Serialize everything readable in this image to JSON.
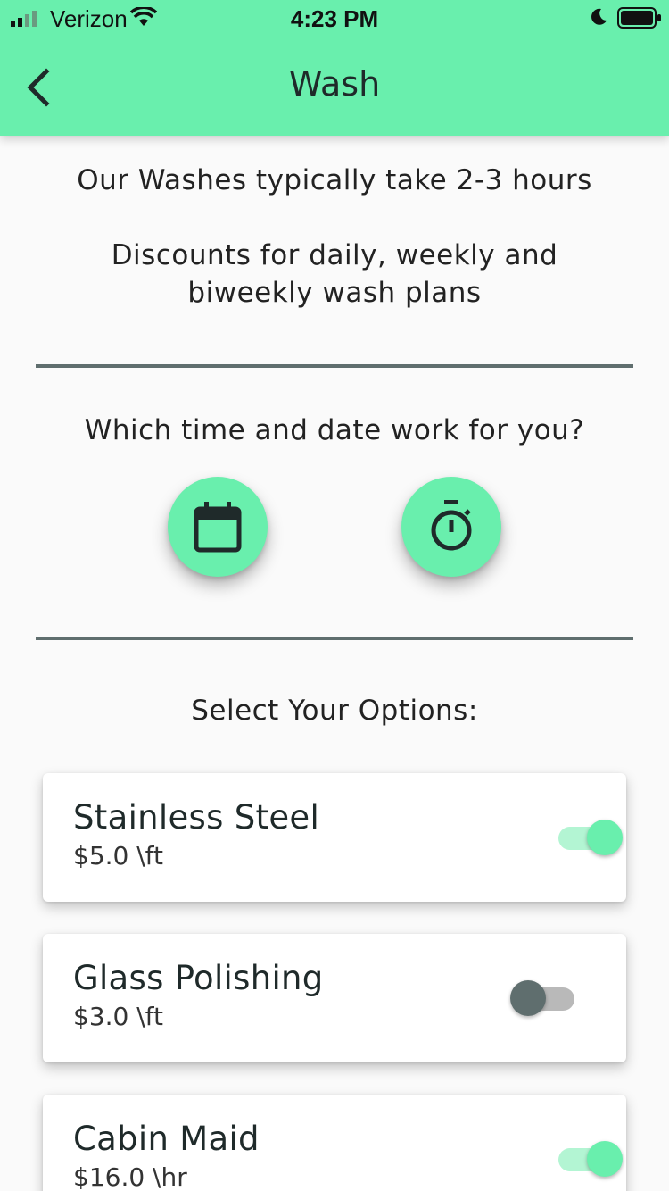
{
  "status_bar": {
    "carrier": "Verizon",
    "time": "4:23 PM"
  },
  "app_bar": {
    "title": "Wash"
  },
  "info": {
    "duration": "Our Washes typically take 2-3 hours",
    "discount_line1": "Discounts for daily, weekly and",
    "discount_line2": "biweekly wash plans"
  },
  "schedule": {
    "prompt": "Which time and date work for you?",
    "date_icon": "calendar-icon",
    "time_icon": "timer-icon"
  },
  "options": {
    "heading": "Select Your Options:",
    "items": [
      {
        "name": "Stainless Steel",
        "price": "$5.0 \\ft",
        "enabled": true
      },
      {
        "name": "Glass Polishing",
        "price": "$3.0 \\ft",
        "enabled": false
      },
      {
        "name": "Cabin Maid",
        "price": "$16.0 \\hr",
        "enabled": true
      }
    ]
  },
  "colors": {
    "accent": "#69efad",
    "divider": "#5f6e6e",
    "background": "#fafafa"
  }
}
